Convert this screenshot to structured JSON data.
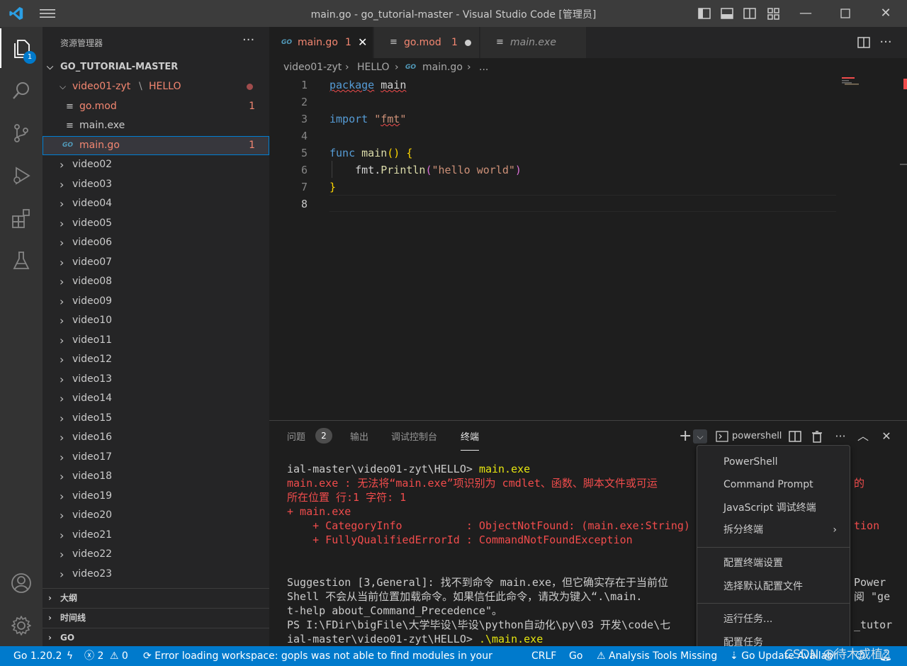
{
  "window": {
    "title": "main.go - go_tutorial-master - Visual Studio Code [管理员]"
  },
  "activity_bar": {
    "explorer_badge": "1",
    "items": [
      "explorer-icon",
      "search-icon",
      "source-control-icon",
      "run-debug-icon",
      "extensions-icon",
      "testing-icon",
      "account-icon",
      "settings-gear-icon"
    ]
  },
  "sidebar": {
    "title": "资源管理器",
    "more": "···",
    "root": "GO_TUTORIAL-MASTER",
    "open_folder": {
      "name": "video01-zyt",
      "sub": "HELLO"
    },
    "files": [
      {
        "name": "go.mod",
        "count": "1"
      },
      {
        "name": "main.exe",
        "count": ""
      },
      {
        "name": "main.go",
        "count": "1"
      }
    ],
    "folders": [
      "video02",
      "video03",
      "video04",
      "video05",
      "video06",
      "video07",
      "video08",
      "video09",
      "video10",
      "video11",
      "video12",
      "video13",
      "video14",
      "video15",
      "video16",
      "video17",
      "video18",
      "video19",
      "video20",
      "video21",
      "video22",
      "video23"
    ],
    "sections": [
      "大纲",
      "时间线",
      "GO"
    ]
  },
  "tabs": [
    {
      "label": "main.go",
      "count": "1",
      "state": "active"
    },
    {
      "label": "go.mod",
      "count": "1",
      "state": "modified"
    },
    {
      "label": "main.exe",
      "count": "",
      "state": "preview"
    }
  ],
  "breadcrumb": [
    "video01-zyt",
    "HELLO",
    "main.go",
    "..."
  ],
  "code": {
    "line_numbers": [
      "1",
      "2",
      "3",
      "4",
      "5",
      "6",
      "7",
      "8"
    ],
    "tokens": {
      "package": "package",
      "main": "main",
      "import": "import",
      "fmt_str": "\"fmt\"",
      "func": "func",
      "main_fn": "main",
      "parens": "()",
      "brace_open": "{",
      "fmt_call": "fmt.",
      "println": "Println",
      "paren_open": "(",
      "hello": "\"hello world\"",
      "paren_close": ")",
      "brace_close": "}"
    }
  },
  "panel": {
    "tabs": [
      "问题",
      "输出",
      "调试控制台",
      "终端"
    ],
    "problems_count": "2",
    "terminal_name": "powershell",
    "terminal_lines": [
      {
        "text": "ial-master\\video01-zyt\\HELLO> ",
        "cmd": "main.exe",
        "style": "normal"
      },
      {
        "text": "main.exe : 无法将“main.exe”项识别为 cmdlet、函数、脚本文件或可运",
        "tail": "的",
        "style": "red"
      },
      {
        "text": "所在位置 行:1 字符: 1",
        "style": "red"
      },
      {
        "text": "+ main.exe",
        "style": "red"
      },
      {
        "text": "    + CategoryInfo          : ObjectNotFound: (main.exe:String)",
        "tail": "tion",
        "style": "red"
      },
      {
        "text": "    + FullyQualifiedErrorId : CommandNotFoundException",
        "style": "red"
      },
      {
        "text": "",
        "style": "normal"
      },
      {
        "text": "",
        "style": "normal"
      },
      {
        "text": "Suggestion [3,General]: 找不到命令 main.exe，但它确实存在于当前位",
        "tail": "Power",
        "style": "normal"
      },
      {
        "text": "Shell 不会从当前位置加载命令。如果信任此命令，请改为键入“.\\main.",
        "tail": "阅 \"ge",
        "style": "normal"
      },
      {
        "text": "t-help about_Command_Precedence\"。",
        "style": "normal"
      },
      {
        "text": "PS I:\\FDir\\bigFile\\大学毕设\\毕设\\python自动化\\py\\03 开发\\code\\七",
        "tail": "_tutor",
        "style": "normal"
      },
      {
        "text": "ial-master\\video01-zyt\\HELLO> ",
        "cmd": ".\\main.exe",
        "style": "normal"
      }
    ]
  },
  "menu": {
    "group1": [
      "PowerShell",
      "Command Prompt",
      "JavaScript 调试终端",
      "拆分终端"
    ],
    "group2": [
      "配置终端设置",
      "选择默认配置文件"
    ],
    "group3": [
      "运行任务...",
      "配置任务"
    ]
  },
  "statusbar": {
    "go_version": "Go 1.20.2",
    "errors": "2",
    "warnings": "0",
    "message": "Error loading workspace: gopls was not able to find modules in your wo",
    "eol": "CRLF",
    "language": "Go",
    "analysis": "Analysis Tools Missing",
    "update": "Go Update Available"
  },
  "watermark": "CSDN @待木成植2",
  "colors": {
    "accent": "#007acc",
    "error": "#f14c4c",
    "status_bar": "#007acc"
  }
}
